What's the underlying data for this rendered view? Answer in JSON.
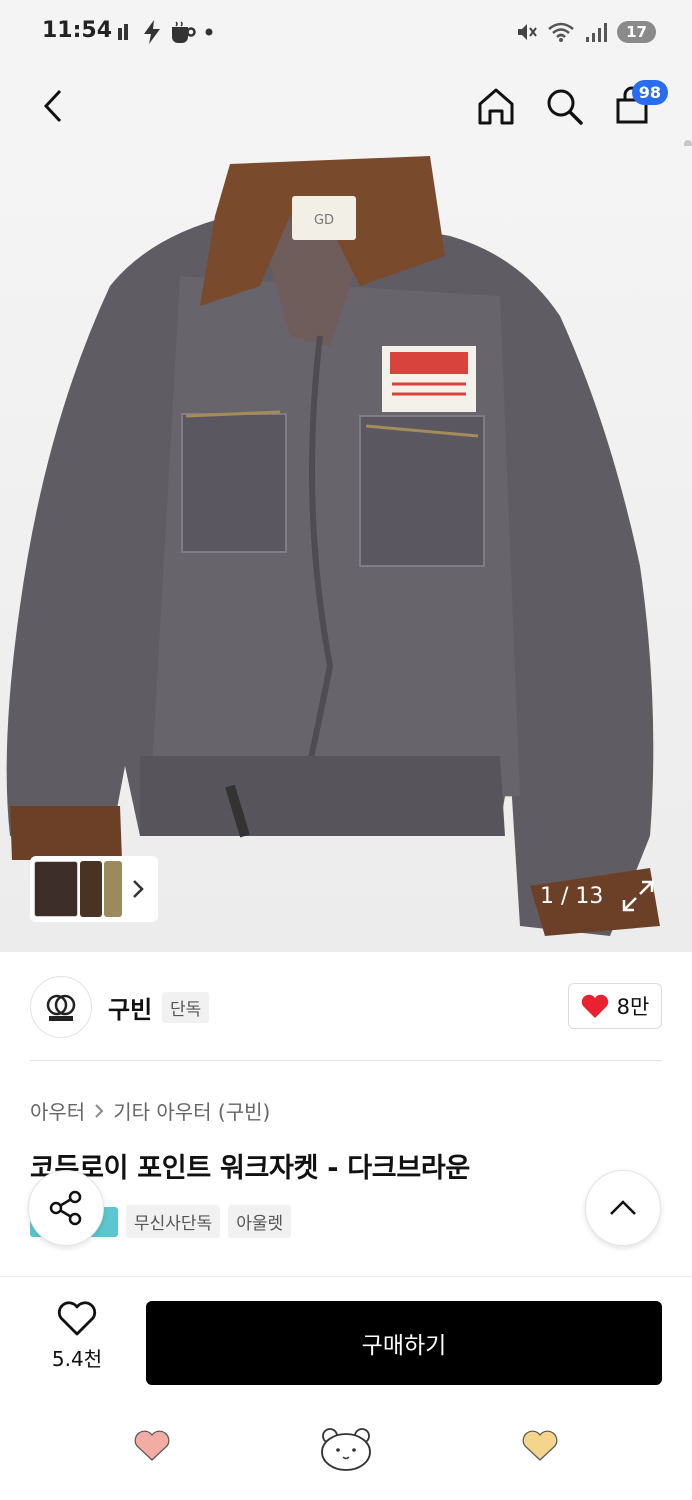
{
  "status_bar": {
    "time": "11:54",
    "battery": "17"
  },
  "header": {
    "cart_count": "98"
  },
  "gallery": {
    "counter": "1 / 13"
  },
  "brand": {
    "name": "구빈",
    "tag": "단독",
    "likes": "8만"
  },
  "product": {
    "breadcrumb": [
      "아우터",
      "기타 아우터 (구빈)"
    ],
    "title": "코듀로이 포인트 워크자켓 - 다크브라운",
    "tags": [
      "무신사단독",
      "아울렛"
    ]
  },
  "purchase": {
    "wish_count": "5.4천",
    "buy_label": "구매하기"
  },
  "colors": {
    "badge_blue": "#2a6cf0",
    "heart_red": "#e8222e",
    "tag_cyan": "#5bc6cf"
  }
}
